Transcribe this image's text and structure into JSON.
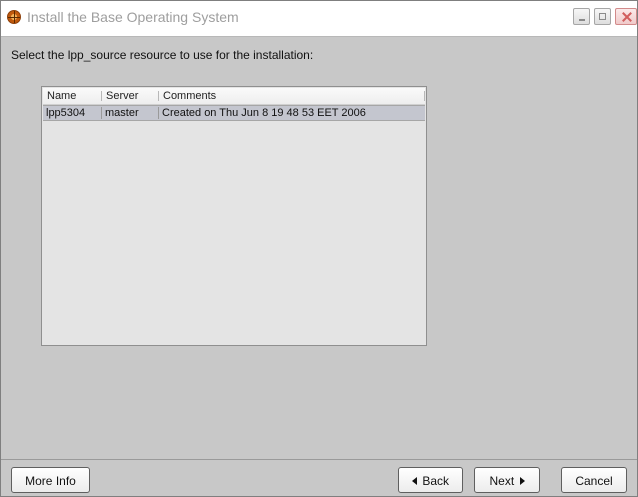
{
  "window": {
    "title": "Install the Base Operating System"
  },
  "instruction": {
    "text": "Select the lpp_source resource to use for the installation:"
  },
  "table": {
    "headers": [
      "Name",
      "Server",
      "Comments"
    ],
    "rows": [
      {
        "name": "lpp5304",
        "server": "master",
        "comments": "Created on Thu Jun 8 19 48 53 EET 2006",
        "selected": true
      }
    ]
  },
  "buttons": {
    "more_info": "More Info",
    "back": "Back",
    "next": "Next",
    "cancel": "Cancel"
  },
  "icons": {
    "app": "crosshair-circle-icon",
    "minimize": "minimize-icon",
    "maximize": "maximize-icon",
    "close": "close-icon",
    "back": "left-arrow-icon",
    "next": "right-arrow-icon"
  },
  "colors": {
    "dialog_background": "#c8c8c8",
    "table_background": "#e4e4e4",
    "selected_row": "#c4c6cf",
    "title_text": "#9e9e9e",
    "close_button": "#d25e5e"
  }
}
